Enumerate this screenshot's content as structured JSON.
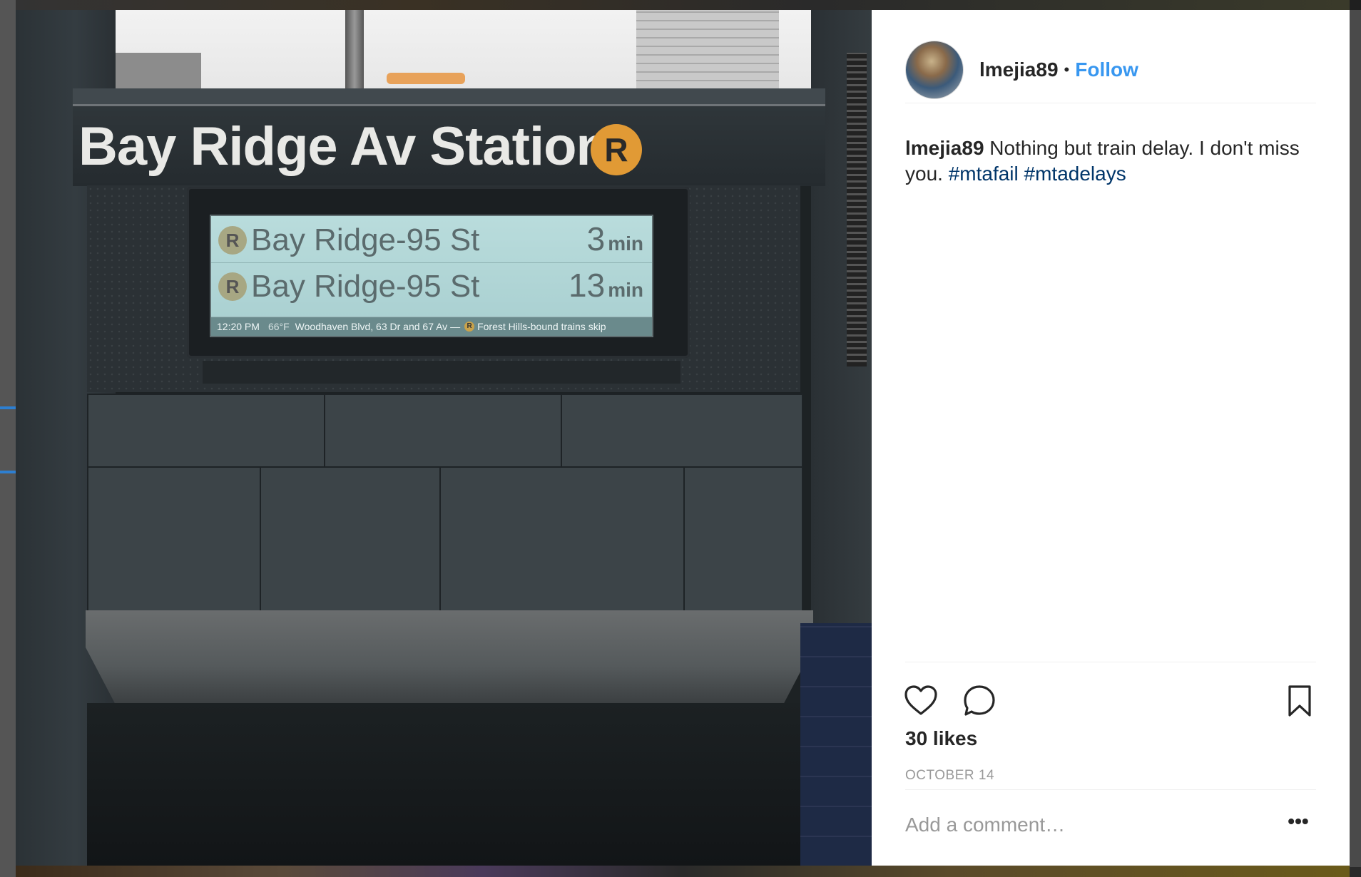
{
  "photo": {
    "station_sign": "Bay Ridge Av Station",
    "route_letter": "R",
    "arrivals": [
      {
        "route": "R",
        "destination": "Bay Ridge-95 St",
        "minutes": "3",
        "unit": "min"
      },
      {
        "route": "R",
        "destination": "Bay Ridge-95 St",
        "minutes": "13",
        "unit": "min"
      }
    ],
    "ticker": {
      "time": "12:20 PM",
      "temp": "66°F",
      "message_a": "Woodhaven Blvd, 63 Dr and 67 Av —",
      "route": "R",
      "message_b": "Forest Hills-bound trains skip"
    }
  },
  "post": {
    "username": "lmejia89",
    "separator": "•",
    "follow_label": "Follow",
    "caption_user": "lmejia89",
    "caption_text": " Nothing but train delay. I don't miss you. ",
    "hashtags": [
      "#mtafail",
      "#mtadelays"
    ],
    "likes": "30 likes",
    "date": "OCTOBER 14",
    "comment_placeholder": "Add a comment…",
    "more_label": "•••"
  },
  "icons": {
    "like": "heart-icon",
    "comment": "comment-icon",
    "save": "bookmark-icon",
    "more": "more-options-icon"
  },
  "colors": {
    "follow": "#3897f0",
    "hashtag": "#003569",
    "route_bullet": "#e19a35",
    "muted": "#999999"
  }
}
